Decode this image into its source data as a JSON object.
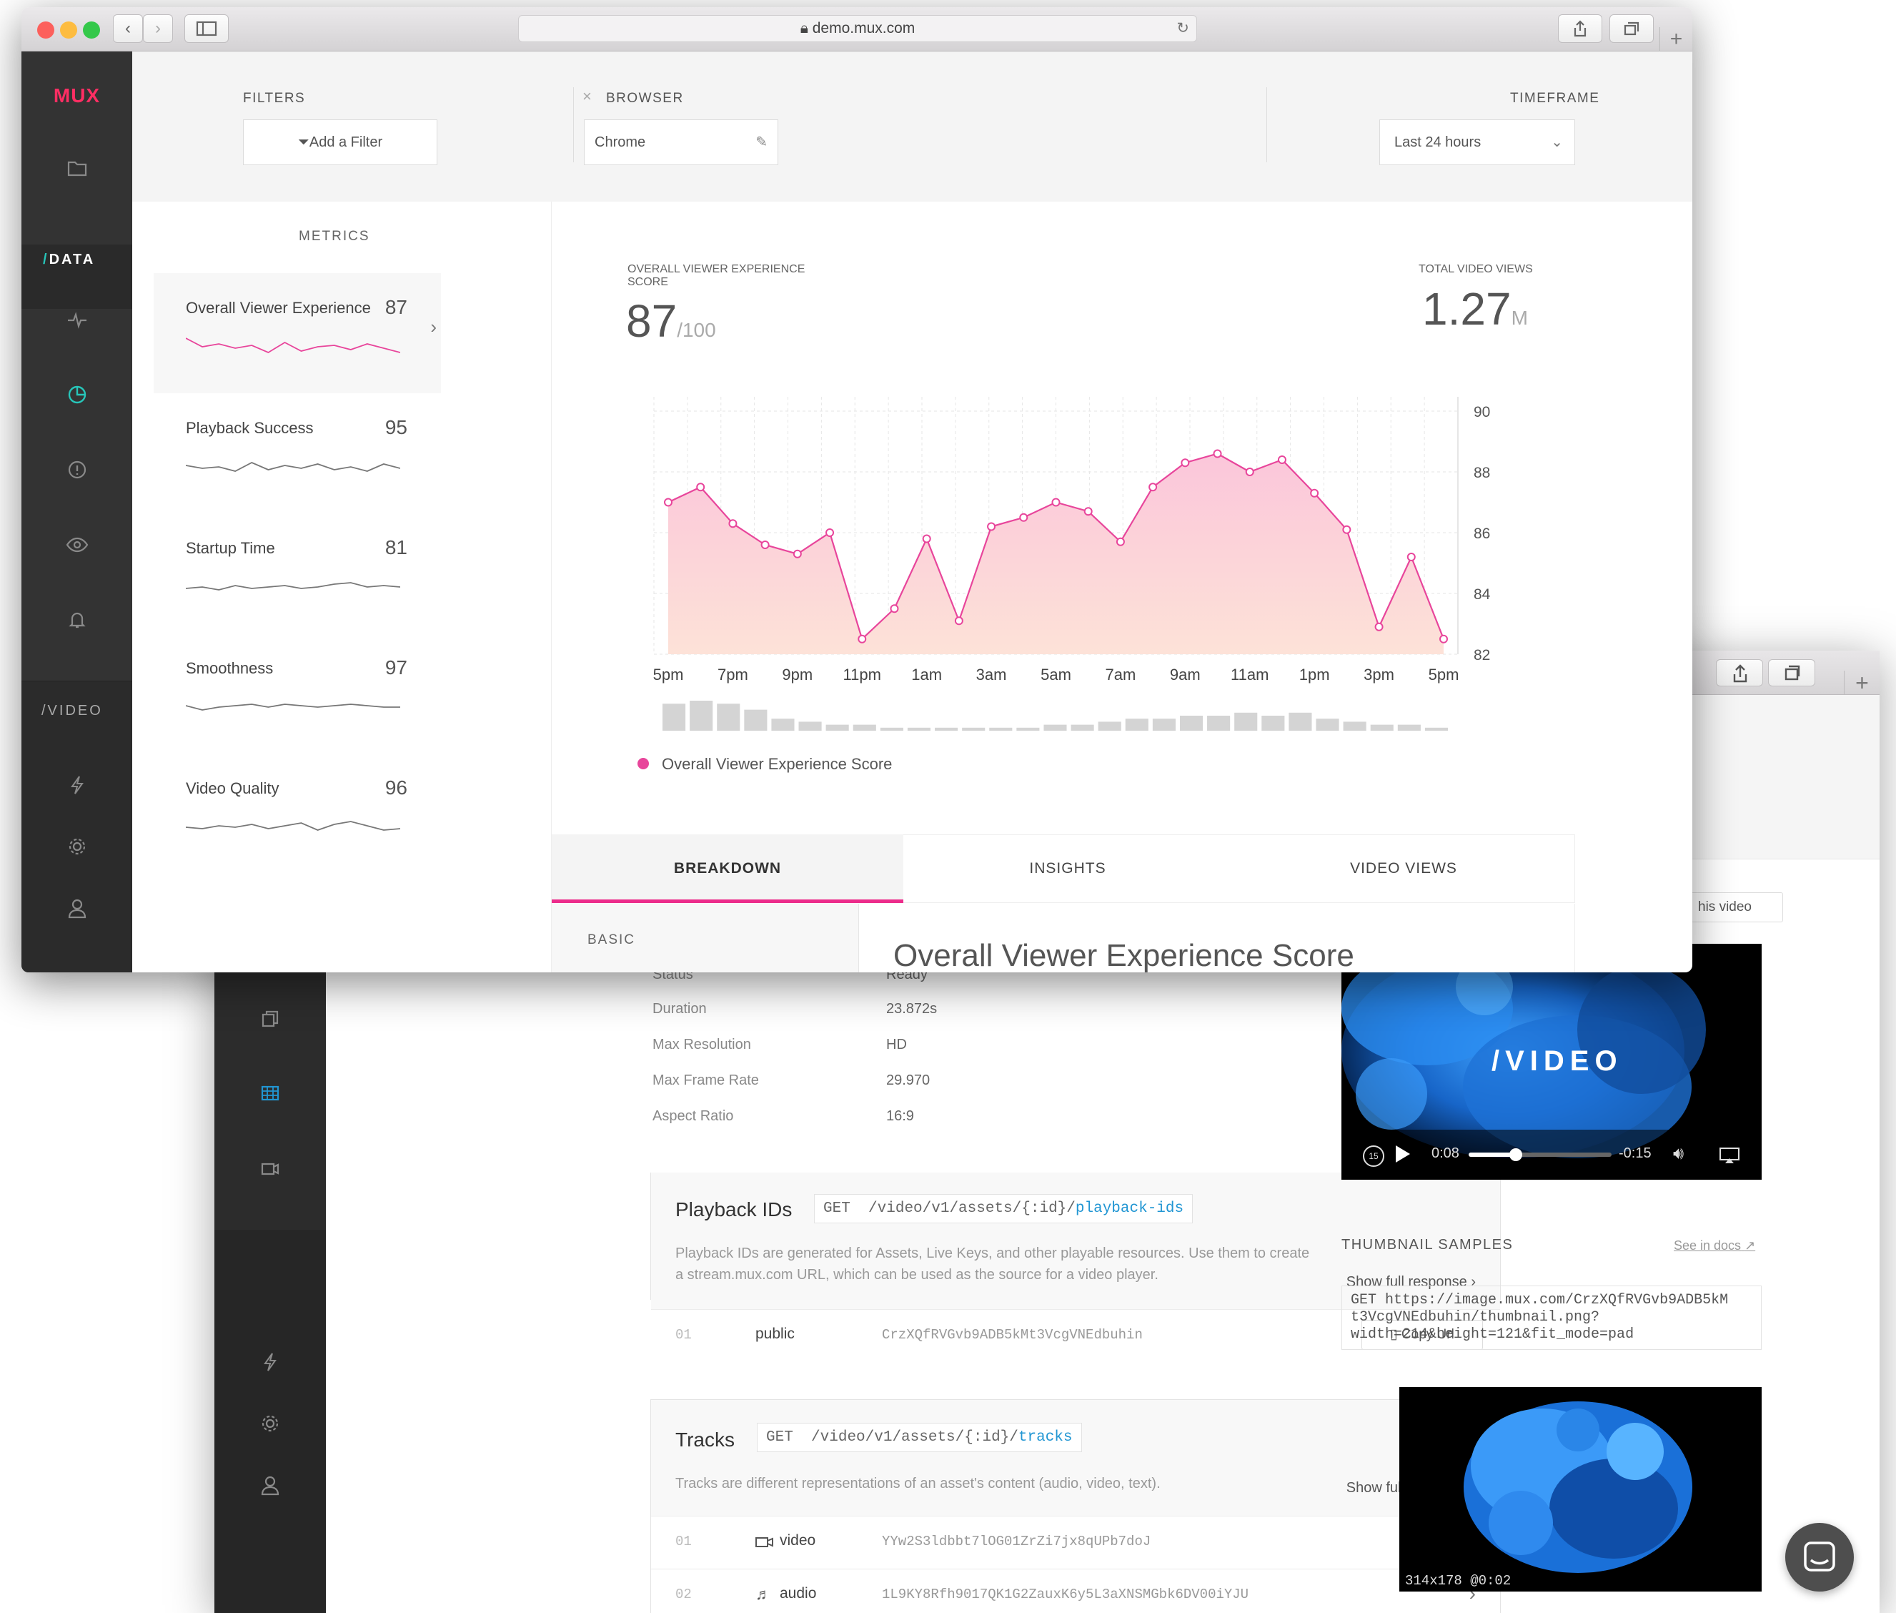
{
  "front": {
    "url": "demo.mux.com",
    "logo": "MUX",
    "sidebar": {
      "data_label": "/DATA",
      "video_label": "/VIDEO",
      "data_slash": "/",
      "data_word": "DATA"
    },
    "filters": {
      "filters_label": "FILTERS",
      "add_filter": "Add a Filter",
      "browser_label": "BROWSER",
      "browser_value": "Chrome",
      "timeframe_label": "TIMEFRAME",
      "timeframe_value": "Last 24 hours"
    },
    "metrics_label": "METRICS",
    "metrics": [
      {
        "name": "Overall Viewer Experience",
        "value": "87"
      },
      {
        "name": "Playback Success",
        "value": "95"
      },
      {
        "name": "Startup Time",
        "value": "81"
      },
      {
        "name": "Smoothness",
        "value": "97"
      },
      {
        "name": "Video Quality",
        "value": "96"
      }
    ],
    "score": {
      "label_line1": "OVERALL VIEWER EXPERIENCE",
      "label_line2": "SCORE",
      "value": "87",
      "denominator": "/100"
    },
    "views": {
      "label": "TOTAL VIDEO VIEWS",
      "value": "1.27",
      "unit": "M"
    },
    "legend": "Overall Viewer Experience Score",
    "tabs": [
      "BREAKDOWN",
      "INSIGHTS",
      "VIDEO VIEWS"
    ],
    "breakdown": {
      "basic_label": "BASIC",
      "heading": "Overall Viewer Experience Score"
    }
  },
  "chart_data": {
    "type": "area",
    "x": [
      "5pm",
      "6pm",
      "7pm",
      "8pm",
      "9pm",
      "10pm",
      "11pm",
      "12am",
      "1am",
      "2am",
      "3am",
      "4am",
      "5am",
      "6am",
      "7am",
      "8am",
      "9am",
      "10am",
      "11am",
      "12pm",
      "1pm",
      "2pm",
      "3pm",
      "4pm",
      "5pm"
    ],
    "xticks": [
      "5pm",
      "7pm",
      "9pm",
      "11pm",
      "1am",
      "3am",
      "5am",
      "7am",
      "9am",
      "11am",
      "1pm",
      "3pm",
      "5pm"
    ],
    "series": [
      {
        "name": "Overall Viewer Experience Score",
        "values": [
          87.0,
          87.5,
          86.3,
          85.6,
          85.3,
          86.0,
          82.5,
          83.5,
          85.8,
          83.1,
          86.2,
          86.5,
          87.0,
          86.7,
          85.7,
          87.5,
          88.3,
          88.6,
          88.0,
          88.4,
          87.3,
          86.1,
          82.9,
          85.2,
          82.5
        ]
      }
    ],
    "views_bars": [
      9,
      10,
      9,
      7,
      4,
      3,
      2,
      2,
      1,
      1,
      1,
      1,
      1,
      1,
      2,
      2,
      3,
      4,
      4,
      5,
      5,
      6,
      5,
      6,
      4,
      3,
      2,
      2,
      1
    ],
    "ylim": [
      82,
      90
    ],
    "yticks": [
      82,
      84,
      86,
      88,
      90
    ],
    "color": "#e8459b",
    "fill": "#fbd3dc",
    "grid": true
  },
  "back": {
    "kv": [
      {
        "label": "Status",
        "value": "Ready"
      },
      {
        "label": "Duration",
        "value": "23.872s"
      },
      {
        "label": "Max Resolution",
        "value": "HD"
      },
      {
        "label": "Max Frame Rate",
        "value": "29.970"
      },
      {
        "label": "Aspect Ratio",
        "value": "16:9"
      }
    ],
    "playback": {
      "title": "Playback IDs",
      "method": "GET",
      "path": "/video/v1/assets/{:id}/",
      "link": "playback-ids",
      "desc": "Playback IDs are generated for Assets, Live Keys, and other playable resources. Use them to create a stream.mux.com URL, which can be used as the source for a video player.",
      "show_full": "Show full response",
      "rows": [
        {
          "num": "01",
          "label": "public",
          "value": "CrzXQfRVGvb9ADB5kMt3VcgVNEdbuhin",
          "action": "Copy Url"
        }
      ]
    },
    "tracks": {
      "title": "Tracks",
      "method": "GET",
      "path": "/video/v1/assets/{:id}/",
      "link": "tracks",
      "desc": "Tracks are different representations of an asset's content (audio, video, text).",
      "show_full": "Show full response",
      "rows": [
        {
          "num": "01",
          "label": "video",
          "value": "YYw2S3ldbbt7lOG01ZrZi7jx8qUPb7doJ"
        },
        {
          "num": "02",
          "label": "audio",
          "value": "1L9KY8Rfh9017QK1G2ZauxK6y5L3aXNSMGbk6DV00iYJU"
        }
      ]
    },
    "player": {
      "button_partial": "his video",
      "overlay": "/VIDEO",
      "elapsed": "0:08",
      "remaining": "-0:15",
      "skip": "15",
      "progress": 0.33
    },
    "thumbnails": {
      "label": "THUMBNAIL SAMPLES",
      "docs": "See in docs",
      "code_line1": "GET https://image.mux.com/CrzXQfRVGvb9ADB5kM",
      "code_line2": "t3VcgVNEdbuhin/thumbnail.png?",
      "code_line3": "width=214&height=121&fit_mode=pad",
      "caption": "314x178 @0:02"
    }
  }
}
